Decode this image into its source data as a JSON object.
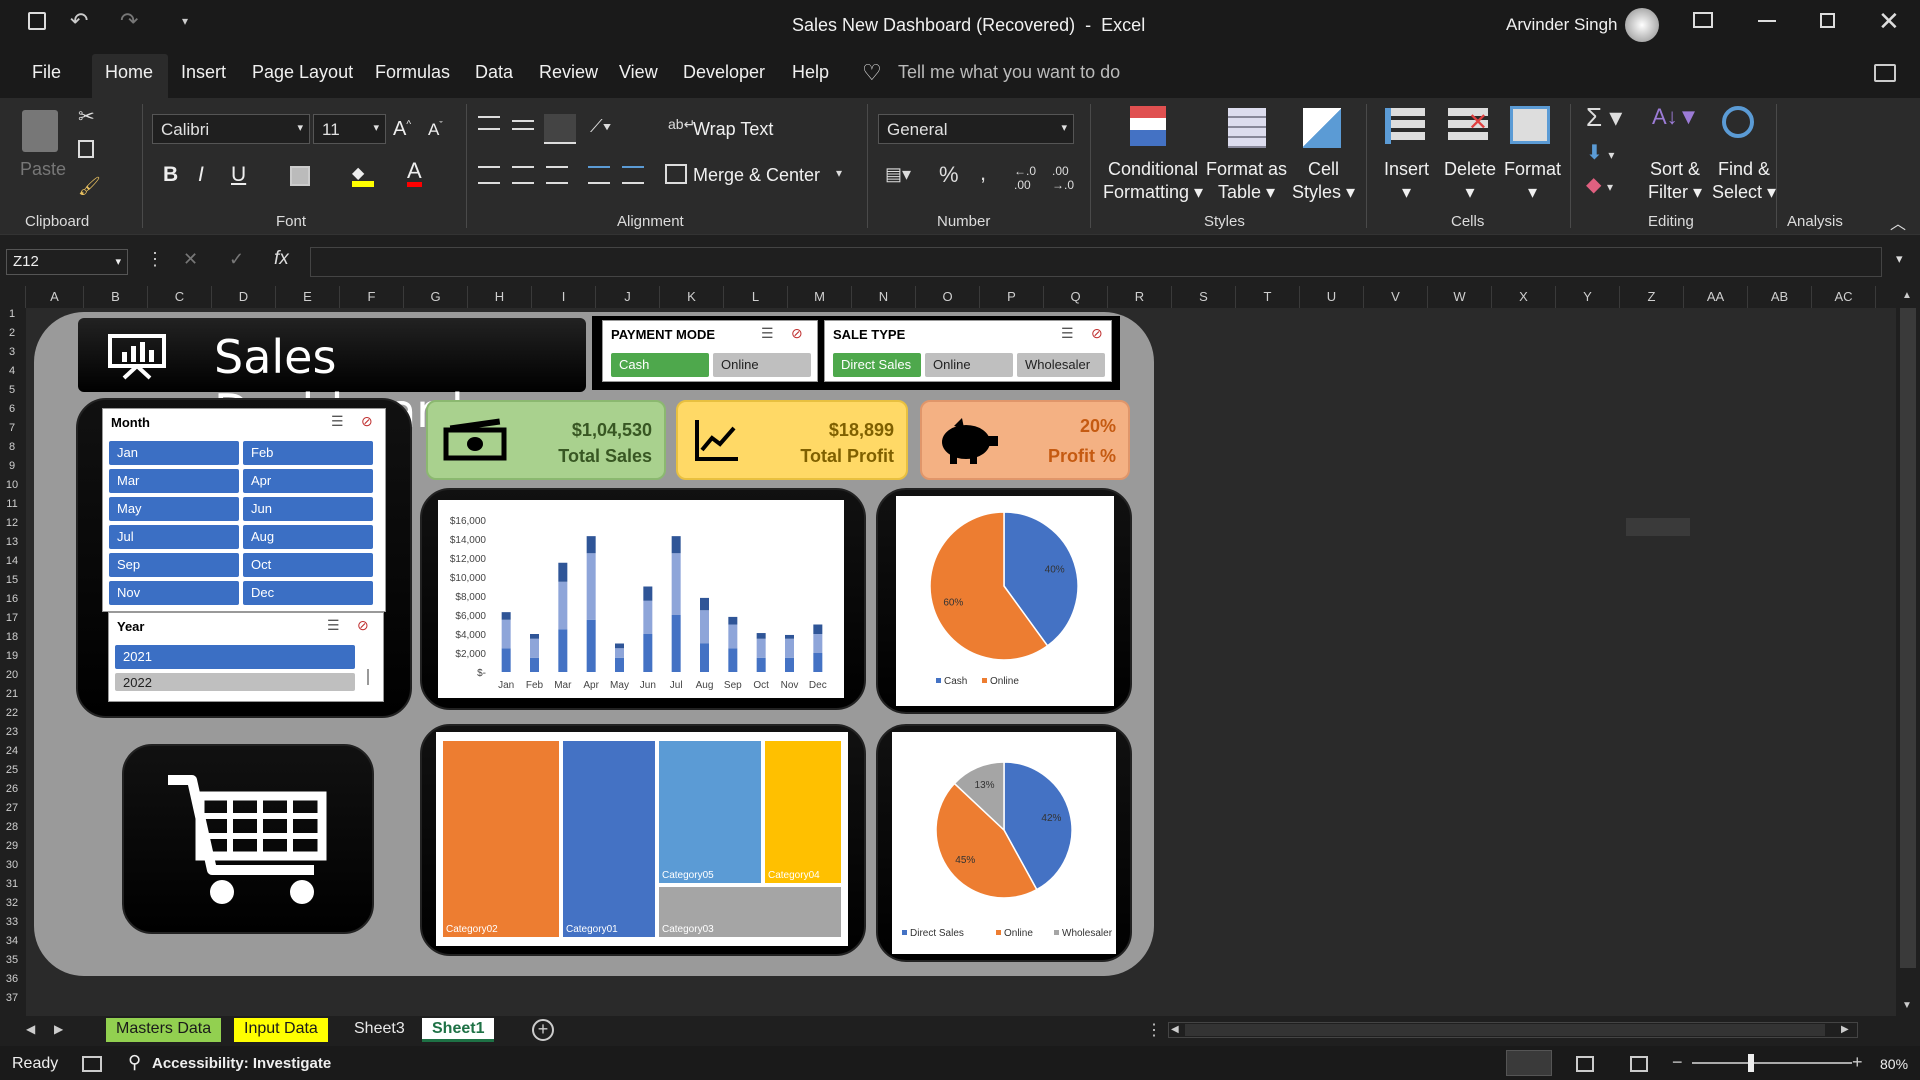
{
  "title": {
    "doc": "Sales New Dashboard (Recovered)",
    "sep": "-",
    "app": "Excel",
    "user": "Arvinder Singh"
  },
  "menu": [
    "File",
    "Home",
    "Insert",
    "Page Layout",
    "Formulas",
    "Data",
    "Review",
    "View",
    "Developer",
    "Help"
  ],
  "tell_me": "Tell me what you want to do",
  "ribbon": {
    "clipboard": {
      "paste": "Paste",
      "label": "Clipboard"
    },
    "font": {
      "name": "Calibri",
      "size": "11",
      "label": "Font"
    },
    "alignment": {
      "wrap": "Wrap Text",
      "merge": "Merge & Center",
      "label": "Alignment"
    },
    "number": {
      "format": "General",
      "label": "Number"
    },
    "styles": {
      "cond1": "Conditional",
      "cond2": "Formatting",
      "fmt1": "Format as",
      "fmt2": "Table",
      "cell1": "Cell",
      "cell2": "Styles",
      "label": "Styles"
    },
    "cells": {
      "insert": "Insert",
      "delete": "Delete",
      "format": "Format",
      "label": "Cells"
    },
    "editing": {
      "sort1": "Sort &",
      "sort2": "Filter",
      "find1": "Find &",
      "find2": "Select",
      "label": "Editing"
    },
    "analysis": {
      "label": "Analysis"
    }
  },
  "namebox": "Z12",
  "columns": [
    "A",
    "B",
    "C",
    "D",
    "E",
    "F",
    "G",
    "H",
    "I",
    "J",
    "K",
    "L",
    "M",
    "N",
    "O",
    "P",
    "Q",
    "R",
    "S",
    "T",
    "U",
    "V",
    "W",
    "X",
    "Y",
    "Z",
    "AA",
    "AB",
    "AC"
  ],
  "rows": [
    "1",
    "2",
    "3",
    "4",
    "5",
    "6",
    "7",
    "8",
    "9",
    "10",
    "11",
    "12",
    "13",
    "14",
    "15",
    "16",
    "17",
    "18",
    "19",
    "20",
    "21",
    "22",
    "23",
    "24",
    "25",
    "26",
    "27",
    "28",
    "29",
    "30",
    "31",
    "32",
    "33",
    "34",
    "35",
    "36",
    "37"
  ],
  "dashboard": {
    "title": "Sales Dashboard",
    "payment_slicer": {
      "title": "PAYMENT MODE",
      "items": [
        "Cash",
        "Online"
      ]
    },
    "sale_slicer": {
      "title": "SALE TYPE",
      "items": [
        "Direct Sales",
        "Online",
        "Wholesaler"
      ]
    },
    "month_slicer": {
      "title": "Month",
      "items": [
        "Jan",
        "Feb",
        "Mar",
        "Apr",
        "May",
        "Jun",
        "Jul",
        "Aug",
        "Sep",
        "Oct",
        "Nov",
        "Dec"
      ]
    },
    "year_slicer": {
      "title": "Year",
      "items": [
        "2021",
        "2022"
      ]
    },
    "kpi": {
      "sales": {
        "value": "$1,04,530",
        "label": "Total Sales"
      },
      "profit": {
        "value": "$18,899",
        "label": "Total Profit"
      },
      "percent": {
        "value": "20%",
        "label": "Profit %"
      }
    }
  },
  "sheets": [
    "Masters Data",
    "Input Data",
    "Sheet3",
    "Sheet1"
  ],
  "status": {
    "ready": "Ready",
    "accessibility": "Accessibility: Investigate",
    "zoom": "80%"
  },
  "chart_data": [
    {
      "type": "bar",
      "stacked": true,
      "categories": [
        "Jan",
        "Feb",
        "Mar",
        "Apr",
        "May",
        "Jun",
        "Jul",
        "Aug",
        "Sep",
        "Oct",
        "Nov",
        "Dec"
      ],
      "series": [
        {
          "values": [
            2500,
            1500,
            4500,
            5500,
            1500,
            4000,
            6000,
            3000,
            2500,
            1500,
            1500,
            2000
          ]
        },
        {
          "values": [
            3000,
            2000,
            5000,
            7000,
            1000,
            3500,
            6500,
            3500,
            2500,
            2000,
            2000,
            2000
          ]
        },
        {
          "values": [
            800,
            500,
            2000,
            1800,
            500,
            1500,
            1800,
            1300,
            800,
            600,
            400,
            1000
          ]
        }
      ],
      "ytick_labels": [
        "$16,000",
        "$14,000",
        "$12,000",
        "$10,000",
        "$8,000",
        "$6,000",
        "$4,000",
        "$2,000",
        "$-"
      ],
      "ylim": [
        0,
        16000
      ],
      "colors": [
        "#4472c4",
        "#8ea5d9",
        "#2f5597"
      ]
    },
    {
      "type": "pie",
      "categories": [
        "Cash",
        "Online"
      ],
      "values": [
        40,
        60
      ],
      "labels": [
        "40%",
        "60%"
      ],
      "colors": [
        "#4472c4",
        "#ed7d31"
      ],
      "legend": "bottom"
    },
    {
      "type": "treemap",
      "categories": [
        "Category02",
        "Category01",
        "Category05",
        "Category04",
        "Category03"
      ],
      "colors": [
        "#ed7d31",
        "#4472c4",
        "#5b9bd5",
        "#ffc000",
        "#a5a5a5"
      ]
    },
    {
      "type": "pie",
      "categories": [
        "Direct Sales",
        "Online",
        "Wholesaler"
      ],
      "values": [
        42,
        45,
        13
      ],
      "labels": [
        "42%",
        "45%",
        "13%"
      ],
      "colors": [
        "#4472c4",
        "#ed7d31",
        "#a5a5a5"
      ],
      "legend": "bottom"
    }
  ]
}
